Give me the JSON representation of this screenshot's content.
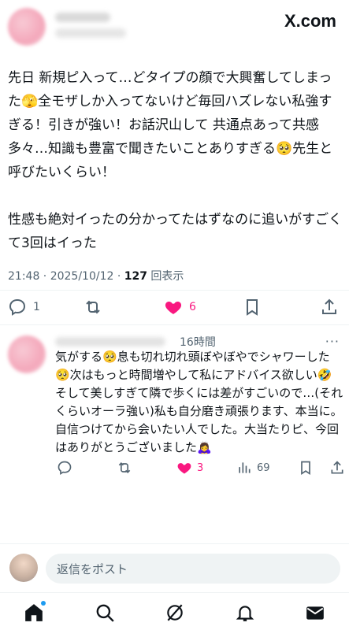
{
  "header": {
    "brand": "X.com"
  },
  "tweet": {
    "text": "先日 新規ピ入って…どタイプの顔で大興奮してしまった🫣全モザしか入ってないけど毎回ハズレない私強すぎる！引きが強い！お話沢山して 共通点あって共感多々…知識も豊富で聞きたいことありすぎる🥺先生と呼びたいくらい！\n\n性感も絶対イったの分かってたはずなのに追いがすごくて3回はイった",
    "timestamp": "21:48 · 2025/10/12 · ",
    "views_count": "127",
    "views_label": " 回表示",
    "replies": "1",
    "likes": "6",
    "like_color": "#f91880"
  },
  "reply": {
    "time": "16時間",
    "more": "···",
    "text": "気がする🥺息も切れ切れ頭ぼやぼやでシャワーした🥺次はもっと時間増やして私にアドバイス欲しい🤣そして美しすぎて隣で歩くには差がすごいので…(それくらいオーラ強い)私も自分磨き頑張ります、本当に。自信つけてから会いたい人でした。大当たりピ、今回はありがとうございました🙇‍♀️",
    "likes": "3",
    "views": "69"
  },
  "composer": {
    "placeholder": "返信をポスト"
  },
  "nav": {
    "items": [
      "home-icon",
      "search-icon",
      "grok-icon",
      "notifications-icon",
      "messages-icon"
    ]
  }
}
